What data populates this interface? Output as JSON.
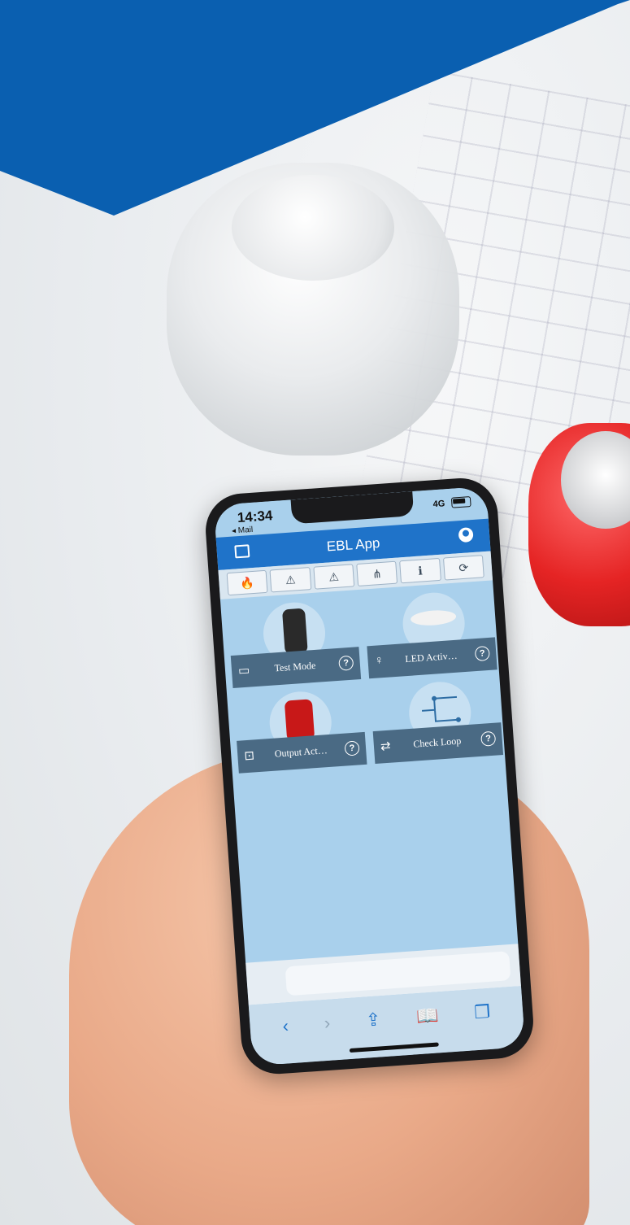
{
  "colors": {
    "banner": "#0a5fb0",
    "appbar": "#1f73c9",
    "screen_bg": "#a9d0ec",
    "card": "#4a6a84"
  },
  "status_bar": {
    "time": "14:34",
    "back_app": "◂ Mail",
    "signal": "4G"
  },
  "app": {
    "title": "EBL App",
    "menu_icon": "sidebar-icon",
    "user_icon": "user-circle-icon"
  },
  "tabs": [
    {
      "icon": "fire-icon",
      "glyph": "🔥"
    },
    {
      "icon": "fire-warning-icon",
      "glyph": "⚠"
    },
    {
      "icon": "warning-triangle-icon",
      "glyph": "⚠"
    },
    {
      "icon": "network-icon",
      "glyph": "⋔"
    },
    {
      "icon": "info-icon",
      "glyph": "ℹ"
    },
    {
      "icon": "sync-icon",
      "glyph": "⟳"
    }
  ],
  "tiles": [
    {
      "label": "Test Mode",
      "icon": "clipboard-icon",
      "glyph": "▭"
    },
    {
      "label": "LED Activ…",
      "icon": "lightbulb-icon",
      "glyph": "♀"
    },
    {
      "label": "Output Act…",
      "icon": "output-icon",
      "glyph": "⊡"
    },
    {
      "label": "Check Loop",
      "icon": "loop-icon",
      "glyph": "⇄"
    }
  ],
  "browser_toolbar": {
    "back": "‹",
    "forward": "›",
    "share": "⇪",
    "bookmarks": "📖",
    "tabs": "❐"
  }
}
